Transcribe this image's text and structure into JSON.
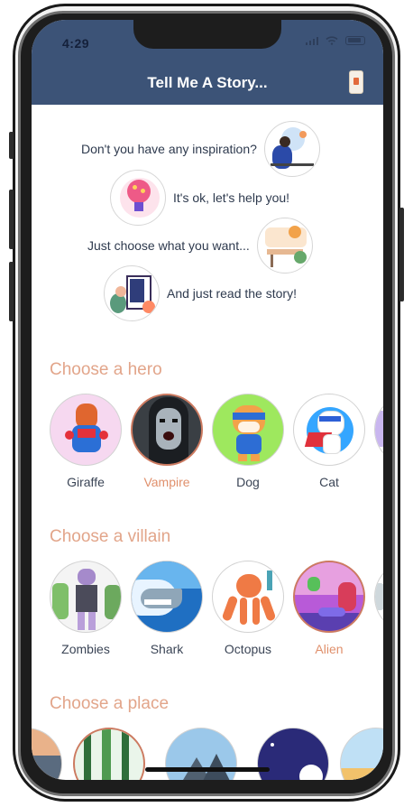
{
  "status_bar": {
    "time": "4:29"
  },
  "header": {
    "title": "Tell Me A Story...",
    "action_icon": "phone-icon"
  },
  "inspiration": [
    {
      "text": "Don't you have any inspiration?",
      "icon": "thinking-person-illustration"
    },
    {
      "text": "It's ok, let's help you!",
      "icon": "lightbulb-illustration"
    },
    {
      "text": "Just choose what you want...",
      "icon": "workspace-illustration"
    },
    {
      "text": "And just read the story!",
      "icon": "reading-illustration"
    }
  ],
  "sections": {
    "hero": {
      "title": "Choose a hero",
      "items": [
        {
          "label": "Giraffe",
          "selected": false
        },
        {
          "label": "Vampire",
          "selected": true
        },
        {
          "label": "Dog",
          "selected": false
        },
        {
          "label": "Cat",
          "selected": false
        }
      ]
    },
    "villain": {
      "title": "Choose a villain",
      "items": [
        {
          "label": "Zombies",
          "selected": false
        },
        {
          "label": "Shark",
          "selected": false
        },
        {
          "label": "Octopus",
          "selected": false
        },
        {
          "label": "Alien",
          "selected": true
        }
      ]
    },
    "place": {
      "title": "Choose a place"
    }
  },
  "colors": {
    "header": "#3c5377",
    "accent": "#e2a58a",
    "selected_border": "#cc7a60"
  }
}
